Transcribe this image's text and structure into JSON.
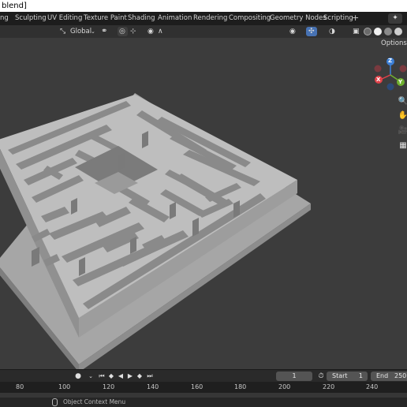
{
  "window": {
    "title": "blend]"
  },
  "workspace_tabs": [
    "ng",
    "Sculpting",
    "UV Editing",
    "Texture Paint",
    "Shading",
    "Animation",
    "Rendering",
    "Compositing",
    "Geometry Nodes",
    "Scripting"
  ],
  "viewport_header": {
    "transform_orientation": "Global"
  },
  "gizmo": {
    "z_label": "Z",
    "x_label": "X",
    "y_label": "Y"
  },
  "viewport": {
    "options_label": "Options"
  },
  "timeline": {
    "current_frame": "1",
    "start_label": "Start",
    "start_value": "1",
    "end_label": "End",
    "end_value": "250"
  },
  "ruler": [
    "80",
    "100",
    "120",
    "140",
    "160",
    "180",
    "200",
    "220",
    "240"
  ],
  "status_bar": {
    "context_menu_hint": "Object Context Menu"
  },
  "colors": {
    "gizmo_x": "#e2424a",
    "gizmo_y": "#6fb02f",
    "gizmo_z": "#3b7fd6",
    "active_blue": "#4772b3",
    "maze_top": "#bdbdbd"
  }
}
